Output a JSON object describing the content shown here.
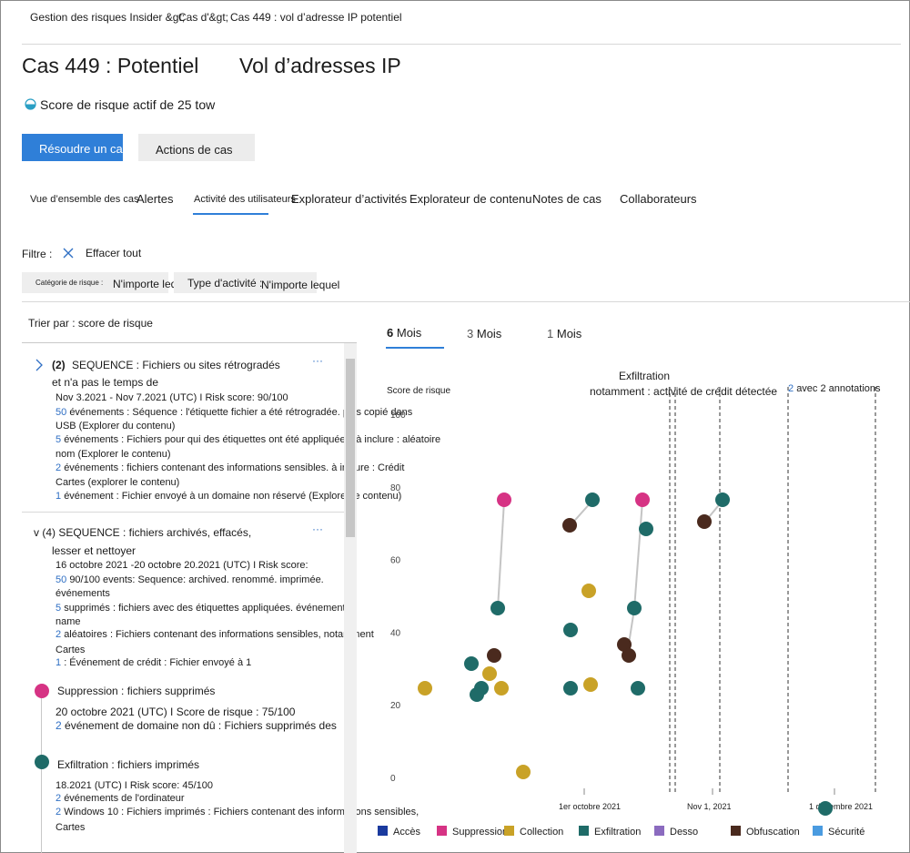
{
  "breadcrumb": {
    "item1": "Gestion des risques Insider &gt;",
    "item2": "Cas d'&gt;",
    "item3": "Cas 449 : vol d’adresse IP potentiel"
  },
  "header": {
    "title_part1": "Cas 449 : Potentiel",
    "title_part2": "Vol d’adresses IP",
    "risk_score": "Score de risque actif de 25 tow"
  },
  "actions": {
    "resolve": "Résoudre un cas",
    "case_actions": "Actions de cas"
  },
  "tabs": [
    {
      "label": "Vue d’ensemble des cas"
    },
    {
      "label": "Alertes"
    },
    {
      "label": "Activité des utilisateurs"
    },
    {
      "label": "Explorateur d’activités"
    },
    {
      "label": "Explorateur de contenu"
    },
    {
      "label": "Notes de cas"
    },
    {
      "label": "Collaborateurs"
    }
  ],
  "filter": {
    "label": "Filtre :",
    "clear": "Effacer tout",
    "risk_category_label": "Catégorie de risque :",
    "risk_category_value": "N'importe lequel",
    "activity_type_label": "Type d'activité :",
    "activity_type_value": "N'importe lequel"
  },
  "sort": "Trier par : score de risque",
  "feed": {
    "seq1": {
      "count": "(2)",
      "title": "SEQUENCE : Fichiers ou sites rétrogradés",
      "title2": "et n'a pas le temps de",
      "more": "···",
      "meta": "Nov 3.2021 - Nov 7.2021 (UTC) I Risk score: 90/100",
      "l1n": "50",
      "l1": "événements : Séquence : l'étiquette fichier a été rétrogradée. puis copié dans",
      "l1b": "USB (Explorer du contenu)",
      "l2n": "5",
      "l2": "événements : Fichiers pour qui des étiquettes ont été appliquées. à inclure : aléatoire",
      "l2b": "nom (Explorer le contenu)",
      "l3n": "2",
      "l3": "événements : fichiers contenant des informations sensibles. à inclure : Crédit",
      "l3b": "Cartes (explorer le contenu)",
      "l4n": "1",
      "l4": "événement : Fichier envoyé à un domaine non réservé (Explorer le contenu)"
    },
    "seq2": {
      "title": "v (4) SEQUENCE : fichiers archivés, effacés,",
      "title2": "lesser et nettoyer",
      "more": "···",
      "meta": "16 octobre 2021 -20 octobre 20.2021 (UTC) I Risk score:",
      "l1n": "50",
      "l1": "90/100 events: Sequence: archived. renommé. imprimée.",
      "l1b": "événements",
      "l2n": "5",
      "l2": "supprimés : fichiers avec des étiquettes appliquées. événements",
      "l2b": "name",
      "l3n": "2",
      "l3": "aléatoires : Fichiers contenant des informations sensibles, notamment",
      "l3b": "Cartes",
      "l4n": "1",
      "l4": ": Événement de crédit : Fichier envoyé à 1"
    },
    "deletion": {
      "title": "Suppression : fichiers supprimés",
      "meta": "20 octobre 2021 (UTC) I Score de risque : 75/100",
      "l1n": "2",
      "l1": "événement de domaine non dû : Fichiers supprimés des"
    },
    "exfil": {
      "title": "Exfiltration : fichiers imprimés",
      "meta": "18.2021 (UTC) I Risk score: 45/100",
      "l1n": "2",
      "l1": "événements de l'ordinateur",
      "l2n": "2",
      "l2": "Windows 10 : Fichiers imprimés : Fichiers contenant des informations sensibles,",
      "l2b": "Cartes"
    }
  },
  "chart_tabs": [
    {
      "num": "6",
      "label": "Mois"
    },
    {
      "num": "3",
      "label": "Mois"
    },
    {
      "num": "1",
      "label": "Mois"
    }
  ],
  "annotations": {
    "a1": "Exfiltration",
    "a2": "notamment : activité de crédit détectée",
    "a3n": "2",
    "a3": "avec 2 annotations"
  },
  "chart_data": {
    "type": "scatter",
    "ylabel": "Score de risque",
    "ylim": [
      0,
      100
    ],
    "yticks": [
      0,
      20,
      40,
      60,
      80,
      100
    ],
    "xticks": [
      "1er octobre 2021",
      "Nov 1, 2021",
      "1 décembre 2021"
    ],
    "colors": {
      "Accès": "#1a3a9e",
      "Suppression": "#d63384",
      "Collection": "#c9a227",
      "Exfiltration": "#1f6b68",
      "Desso": "#8b6bbf",
      "Obfuscation": "#4a2a1e",
      "Sécurité": "#4a9be0"
    },
    "legend": [
      "Accès",
      "Suppression",
      "Collection",
      "Exfiltration",
      "Desso",
      "Obfuscation",
      "Sécurité"
    ]
  }
}
